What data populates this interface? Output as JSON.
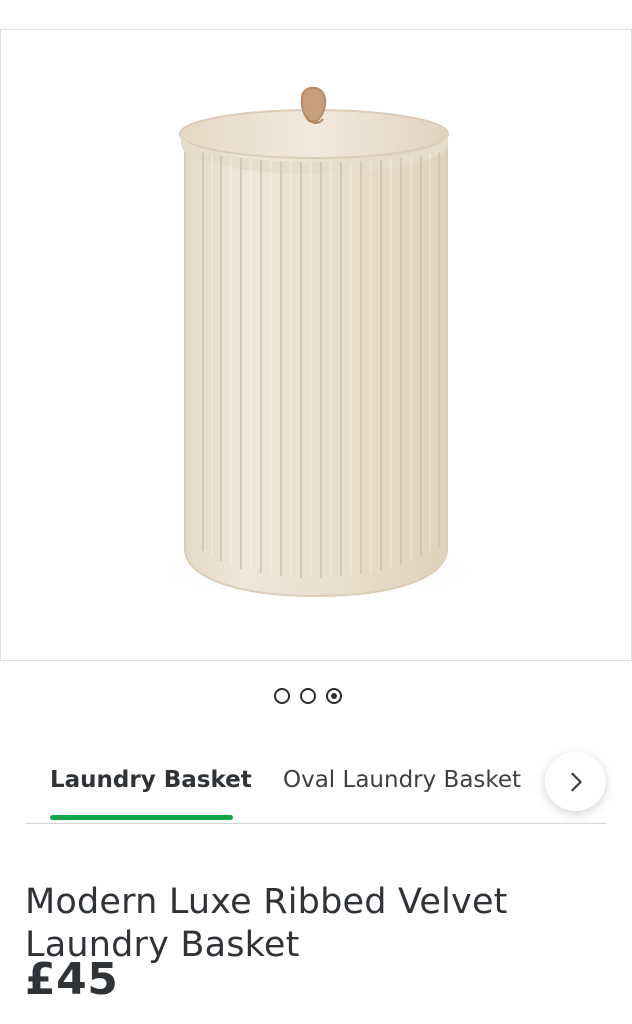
{
  "gallery": {
    "image_icon": "product-image",
    "dots": [
      {
        "active": false
      },
      {
        "active": false
      },
      {
        "active": true
      }
    ]
  },
  "tabs": {
    "items": [
      {
        "label": "Laundry Basket",
        "selected": true
      },
      {
        "label": "Oval Laundry Basket",
        "selected": false
      }
    ],
    "next_icon": "chevron-right-icon"
  },
  "product": {
    "title": "Modern Luxe Ribbed Velvet Laundry Basket",
    "price": "£45"
  },
  "colors": {
    "accent": "#13a64b",
    "text": "#2f3337",
    "border": "#d4d4d4",
    "product": "#e9dfcf"
  }
}
